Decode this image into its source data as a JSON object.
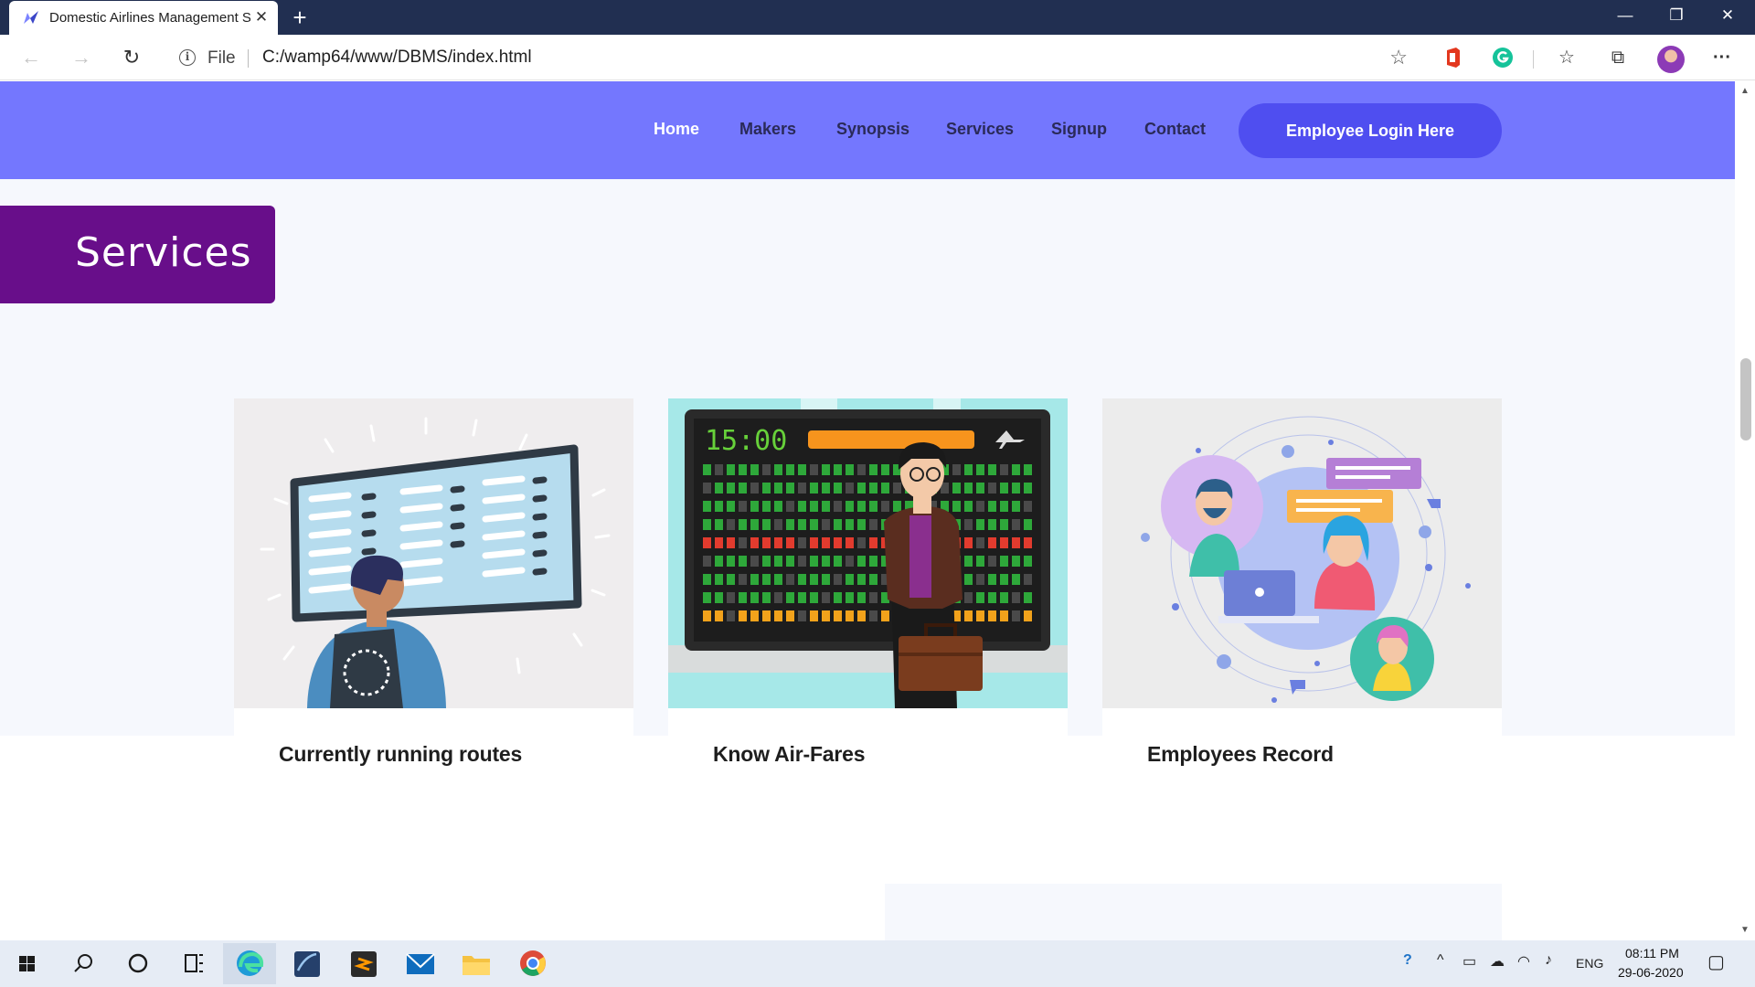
{
  "browser": {
    "tab_title": "Domestic Airlines Management S",
    "tab_close": "✕",
    "new_tab": "+",
    "window_controls": {
      "minimize": "—",
      "restore": "❐",
      "close": "✕"
    },
    "nav": {
      "back": "←",
      "forward": "→",
      "refresh": "↻"
    },
    "address": {
      "info": "i",
      "scheme_label": "File",
      "url": "C:/wamp64/www/DBMS/index.html"
    },
    "more": "···"
  },
  "site": {
    "nav_items": [
      {
        "label": "Home",
        "active": true
      },
      {
        "label": "Makers",
        "active": false
      },
      {
        "label": "Synopsis",
        "active": false
      },
      {
        "label": "Services",
        "active": false
      },
      {
        "label": "Signup",
        "active": false
      },
      {
        "label": "Contact",
        "active": false
      }
    ],
    "login_button": "Employee Login Here",
    "section_heading": "Services",
    "cards": [
      {
        "title": "Currently running routes",
        "illustration": "flight-board-traveler"
      },
      {
        "title": "Know Air-Fares",
        "illustration": "departure-board-businessman"
      },
      {
        "title": "Employees Record",
        "illustration": "support-team-chat"
      }
    ],
    "departure_board_time": "15:00"
  },
  "colors": {
    "nav_bg": "#7477fe",
    "nav_link": "#2a2a58",
    "login_button_bg": "#4f4ef0",
    "heading_bg": "#680e8a",
    "section_bg": "#f6f8fd",
    "tabstrip_bg": "#212f51"
  },
  "taskbar": {
    "language": "ENG",
    "time": "08:11 PM",
    "date": "29-06-2020",
    "apps": [
      "windows-start",
      "search",
      "cortana",
      "task-view",
      "edge",
      "mysql-workbench",
      "sublime-text",
      "mail",
      "file-explorer",
      "chrome"
    ]
  }
}
